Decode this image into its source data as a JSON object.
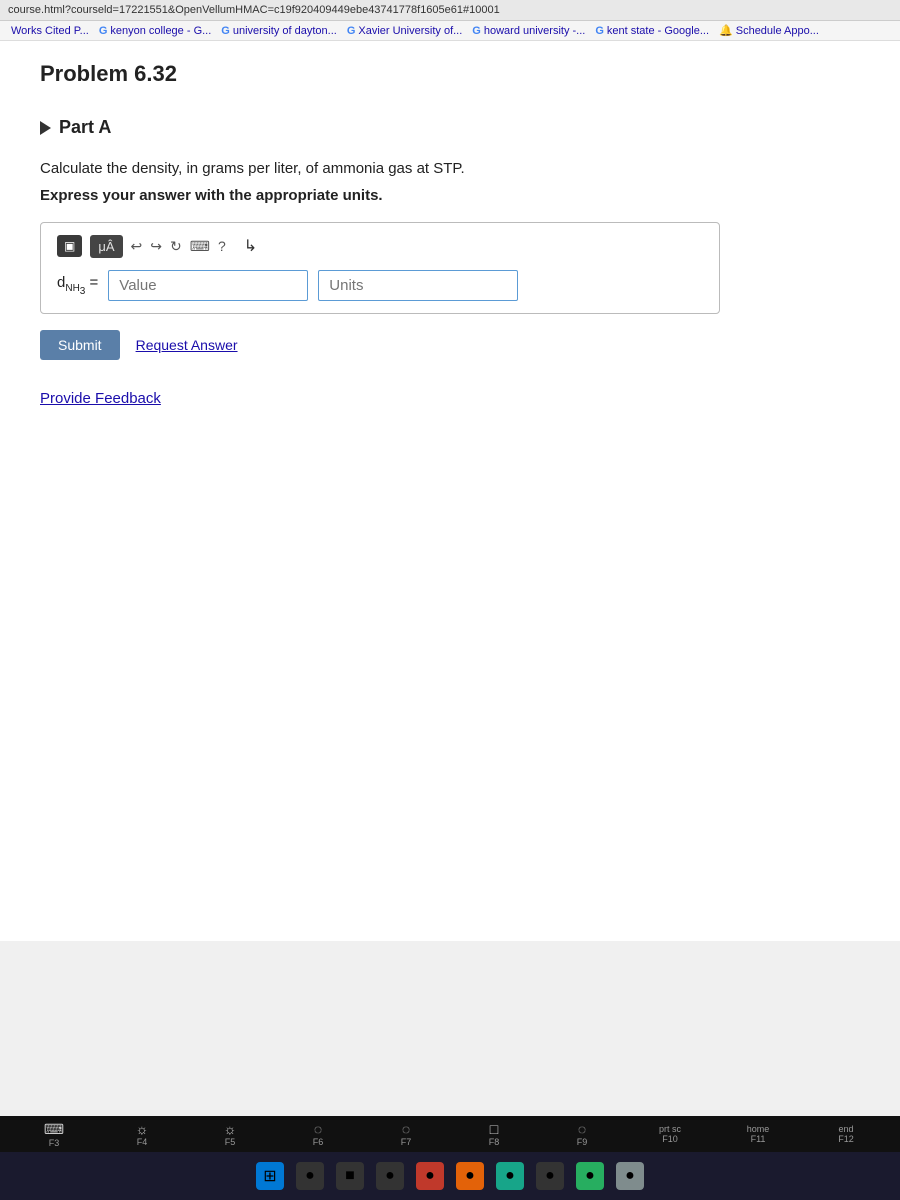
{
  "browser": {
    "url": "course.html?courseld=17221551&OpenVellumHMAC=c19f920409449ebe43741778f1605e61#10001"
  },
  "bookmarks": [
    {
      "label": "Works Cited P..."
    },
    {
      "label": "kenyon college - G..."
    },
    {
      "label": "university of dayton..."
    },
    {
      "label": "Xavier University of..."
    },
    {
      "label": "howard university -..."
    },
    {
      "label": "kent state - Google..."
    },
    {
      "label": "Schedule Appo..."
    }
  ],
  "problem": {
    "title": "Problem 6.32",
    "part_label": "Part A",
    "question_line1": "Calculate the density, in grams per liter, of ammonia gas at STP.",
    "question_line2": "Express your answer with the appropriate units.",
    "equation_label": "dᴺᴴ₃ =",
    "value_placeholder": "Value",
    "units_placeholder": "Units",
    "submit_label": "Submit",
    "request_answer_label": "Request Answer",
    "provide_feedback_label": "Provide Feedback"
  },
  "toolbar": {
    "block_icon": "▣",
    "mu_label": "μÂ",
    "undo_label": "↩",
    "redo_label": "↪",
    "refresh_label": "↻",
    "keyboard_label": "⌨",
    "help_label": "?"
  },
  "fkeys": [
    {
      "label": "F3",
      "icon": "⌨",
      "sub": ""
    },
    {
      "label": "F4",
      "icon": "☀",
      "sub": ""
    },
    {
      "label": "F5",
      "icon": "☀",
      "sub": ""
    },
    {
      "label": "F6",
      "icon": "",
      "sub": ""
    },
    {
      "label": "F7",
      "icon": "",
      "sub": ""
    },
    {
      "label": "F8",
      "icon": "□",
      "sub": ""
    },
    {
      "label": "F9",
      "icon": "",
      "sub": ""
    },
    {
      "label": "F10",
      "icon": "",
      "sub": "prt sc"
    },
    {
      "label": "home",
      "icon": "",
      "sub": ""
    },
    {
      "label": "end",
      "icon": "",
      "sub": ""
    }
  ],
  "taskbar_icons": [
    {
      "type": "blue",
      "symbol": "⊞"
    },
    {
      "type": "orange",
      "symbol": "●"
    },
    {
      "type": "dark",
      "symbol": "■"
    },
    {
      "type": "dark",
      "symbol": "●"
    },
    {
      "type": "red",
      "symbol": "●"
    },
    {
      "type": "orange",
      "symbol": "●"
    },
    {
      "type": "teal",
      "symbol": "●"
    },
    {
      "type": "dark",
      "symbol": "●"
    },
    {
      "type": "green",
      "symbol": "●"
    },
    {
      "type": "gray",
      "symbol": "●"
    }
  ]
}
